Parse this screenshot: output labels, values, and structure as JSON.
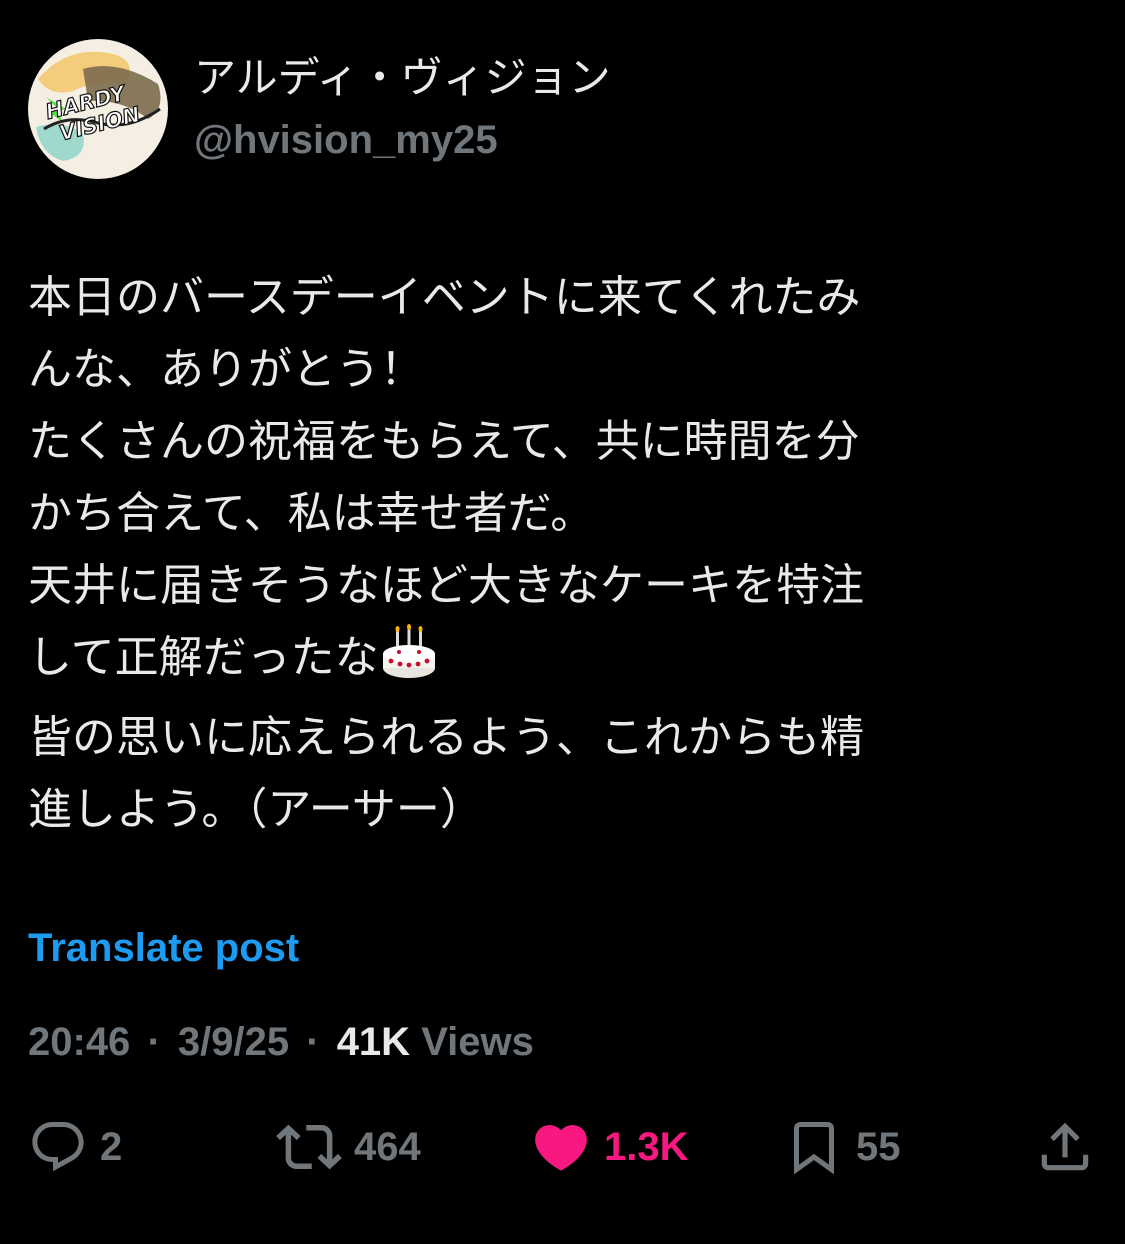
{
  "author": {
    "display_name": "アルディ・ヴィジョン",
    "handle": "@hvision_my25",
    "avatar_logo_text": "HARDY VISION",
    "avatar_icon": "avatar-logo"
  },
  "post": {
    "lines": [
      "本日のバースデーイベントに来てくれたみ",
      "んな、ありがとう！",
      "たくさんの祝福をもらえて、共に時間を分",
      "かち合えて、私は幸せ者だ。",
      "天井に届きそうなほど大きなケーキを特注",
      "して正解だったな",
      "皆の思いに応えられるよう、これからも精",
      "進しよう。（アーサー）"
    ],
    "emoji": "birthday-cake-icon"
  },
  "translate_label": "Translate post",
  "meta": {
    "time": "20:46",
    "date": "3/9/25",
    "views_count": "41K",
    "views_label": "Views",
    "separator": "·"
  },
  "actions": {
    "replies": {
      "icon": "reply-icon",
      "count": "2"
    },
    "reposts": {
      "icon": "repost-icon",
      "count": "464"
    },
    "likes": {
      "icon": "heart-icon",
      "count": "1.3K",
      "liked": true
    },
    "bookmarks": {
      "icon": "bookmark-icon",
      "count": "55"
    },
    "share": {
      "icon": "share-icon"
    }
  },
  "colors": {
    "background": "#000000",
    "text_primary": "#e7e9ea",
    "text_secondary": "#71767b",
    "link": "#1d9bf0",
    "like": "#f91880"
  }
}
